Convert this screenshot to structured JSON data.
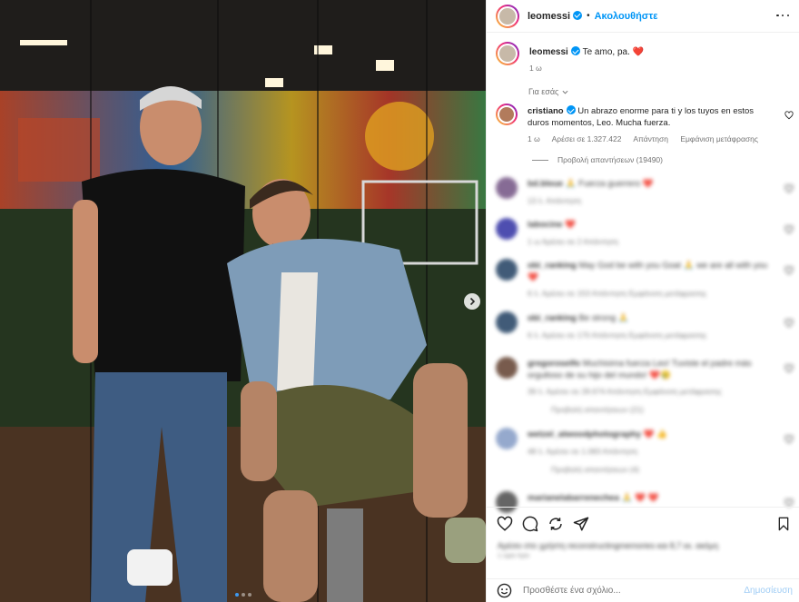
{
  "post": {
    "author": "leomessi",
    "follow_label": "Ακολουθήστε",
    "separator": "•",
    "caption_text": "Te amo, pa. ❤️",
    "caption_time": "1 ω",
    "slide_index": 1,
    "slide_count": 3
  },
  "comments_filter": {
    "label": "Για εσάς"
  },
  "top_comment": {
    "username": "cristiano",
    "text": "Un abrazo enorme para ti y los tuyos en estos duros momentos, Leo. Mucha fuerza.",
    "time": "1 ω",
    "likes": "Αρέσει σε 1.327.422",
    "reply_label": "Απάντηση",
    "translate_label": "Εμφάνιση μετάφρασης",
    "view_replies": "Προβολή απαντήσεων (19490)"
  },
  "blurred_comments": [
    {
      "username": "bd.bleue",
      "text": "🙏 Fuerza guerrero ❤️",
      "meta": "13 λ. Απάντηση"
    },
    {
      "username": "labocine",
      "text": "❤️",
      "meta": "1 ω Αρέσει σε 2 Απάντηση"
    },
    {
      "username": "obi_ranking",
      "text": "May God be with you Goat 🙏 we are all with you ❤️",
      "meta": "6 λ. Αρέσει σε 153 Απάντηση Εμφάνιση μετάφρασης"
    },
    {
      "username": "obi_ranking",
      "text": "Be strong 🙏",
      "meta": "6 λ. Αρέσει σε 170 Απάντηση Εμφάνιση μετάφρασης"
    },
    {
      "username": "gregoroselfo",
      "text": "Muchisima fuerza Leo! Tuviste el padre más orgulloso de su hijo del mundo! ❤️😢",
      "meta": "39 λ. Αρέσει σε 28.674 Απάντηση Εμφάνιση μετάφρασης",
      "replies": "Προβολή απαντήσεων (21)"
    },
    {
      "username": "wetzel_atwoodphotography",
      "text": "❤️ 👍",
      "meta": "48 λ. Αρέσει σε 1.083 Απάντηση",
      "replies": "Προβολή απαντήσεων (4)"
    },
    {
      "username": "marianelabarrenechea",
      "text": "🙏 ❤️ ❤️",
      "meta": ""
    }
  ],
  "likes": {
    "text": "Αρέσει στο χρήστη reconstructingmemories και 8,7 εκ. ακόμη",
    "time": "1 ώρα πριν"
  },
  "composer": {
    "placeholder": "Προσθέστε ένα σχόλιο...",
    "post_label": "Δημοσίευση"
  },
  "colors": {
    "accent": "#0095f6",
    "heart": "#ff3040",
    "muted": "#737373"
  },
  "icons": [
    "more-icon",
    "chevron-down-icon",
    "heart-icon",
    "like-icon",
    "comment-icon",
    "share-icon",
    "send-icon",
    "bookmark-icon",
    "emoji-icon",
    "chevron-right-icon"
  ]
}
